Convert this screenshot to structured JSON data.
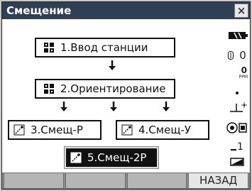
{
  "window": {
    "title": "Смещение",
    "close_glyph": "×"
  },
  "menu": {
    "items": [
      {
        "label": "1.Ввод станции",
        "icon": "grid-icon"
      },
      {
        "label": "2.Ориентирование",
        "icon": "grid-icon"
      },
      {
        "label": "3.Смещ-Р",
        "icon": "offset-icon"
      },
      {
        "label": "4.Смещ-У",
        "icon": "offset-icon"
      },
      {
        "label": "5.Смещ-2Р",
        "icon": "offset-icon",
        "selected": true
      }
    ]
  },
  "status_bar": {
    "battery_icon": "battery-icon",
    "prism_constant": "0",
    "ppm_value": "0",
    "ppm_unit": "PPM",
    "tilt_icon": "tilt-icon",
    "target_icon": "target-icon",
    "face_value": "1"
  },
  "softkeys": [
    "",
    "",
    "",
    "НАЗАД"
  ],
  "colors": {
    "titlebar": "#2f3f54",
    "selected_bg": "#111111"
  }
}
